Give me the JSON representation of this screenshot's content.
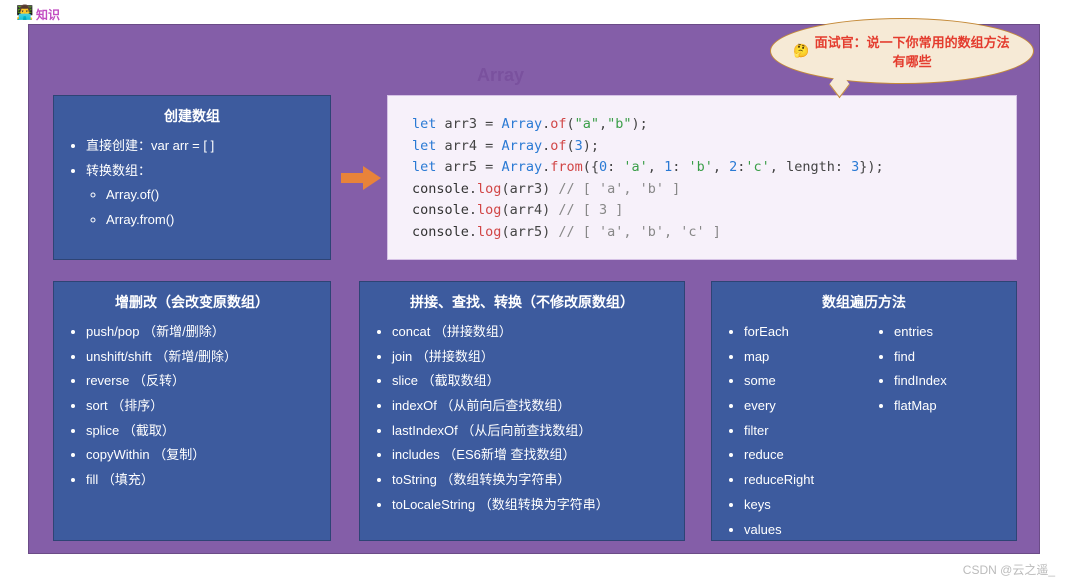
{
  "tag_label": "知识",
  "avatar_emoji": "👨‍💻",
  "board_title": "Array",
  "bubble": {
    "emoji": "🤔",
    "text": "面试官：说一下你常用的数组方法有哪些"
  },
  "create": {
    "title": "创建数组",
    "direct": "直接创建：var arr = [ ]",
    "convert_label": "转换数组：",
    "convert_items": [
      "Array.of()",
      "Array.from()"
    ]
  },
  "mutate": {
    "title": "增删改（会改变原数组）",
    "items": [
      "push/pop （新增/删除）",
      "unshift/shift （新增/删除）",
      "reverse （反转）",
      "sort （排序）",
      "splice （截取）",
      "copyWithin （复制）",
      "fill （填充）"
    ]
  },
  "inspect": {
    "title": "拼接、查找、转换（不修改原数组）",
    "items": [
      "concat （拼接数组）",
      "join （拼接数组）",
      "slice （截取数组）",
      "indexOf （从前向后查找数组）",
      "lastIndexOf （从后向前查找数组）",
      "includes （ES6新增 查找数组）",
      "toString （数组转换为字符串）",
      "toLocaleString （数组转换为字符串）"
    ]
  },
  "iter": {
    "title": "数组遍历方法",
    "col1": [
      "forEach",
      "map",
      "some",
      "every",
      "filter",
      "reduce",
      "reduceRight",
      "keys",
      "values"
    ],
    "col2": [
      "entries",
      "find",
      "findIndex",
      "flatMap"
    ]
  },
  "code": {
    "l1_kw": "let",
    "l1_var": " arr3 ",
    "l1_eq": "= ",
    "l1_cls": "Array",
    "l1_dot": ".",
    "l1_fn": "of",
    "l1_open": "(",
    "l1_a": "\"a\"",
    "l1_c": ",",
    "l1_b": "\"b\"",
    "l1_close": ");",
    "l2_kw": "let",
    "l2_var": " arr4 ",
    "l2_eq": "= ",
    "l2_cls": "Array",
    "l2_dot": ".",
    "l2_fn": "of",
    "l2_open": "(",
    "l2_n": "3",
    "l2_close": ");",
    "l3_kw": "let",
    "l3_var": " arr5 ",
    "l3_eq": "= ",
    "l3_cls": "Array",
    "l3_dot": ".",
    "l3_fn": "from",
    "l3_open": "({",
    "l3_k0": "0",
    "l3_c1": ": ",
    "l3_v0": "'a'",
    "l3_s1": ", ",
    "l3_k1": "1",
    "l3_c2": ": ",
    "l3_v1": "'b'",
    "l3_s2": ", ",
    "l3_k2": "2",
    "l3_c3": ":",
    "l3_v2": "'c'",
    "l3_s3": ", ",
    "l3_len": "length",
    "l3_c4": ": ",
    "l3_vn": "3",
    "l3_close": "});",
    "l4_obj": "console",
    "l4_dot": ".",
    "l4_fn": "log",
    "l4_open": "(",
    "l4_arg": "arr3",
    "l4_close": ") ",
    "l4_com": "// [ 'a', 'b' ]",
    "l5_obj": "console",
    "l5_dot": ".",
    "l5_fn": "log",
    "l5_open": "(",
    "l5_arg": "arr4",
    "l5_close": ") ",
    "l5_com": "// [ 3 ]",
    "l6_obj": "console",
    "l6_dot": ".",
    "l6_fn": "log",
    "l6_open": "(",
    "l6_arg": "arr5",
    "l6_close": ") ",
    "l6_com": "// [ 'a', 'b', 'c' ]"
  },
  "watermark": "CSDN @云之遥_"
}
